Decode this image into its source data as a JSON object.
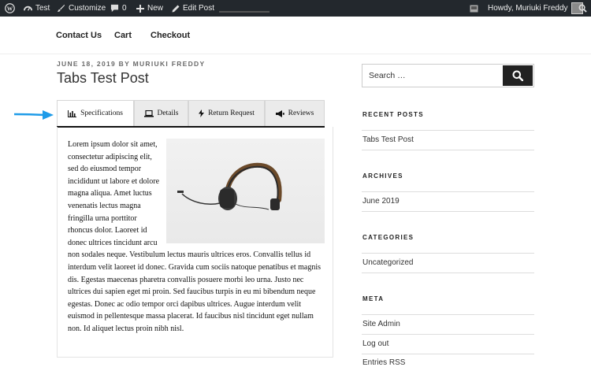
{
  "admin_bar": {
    "site_name": "Test",
    "customize": "Customize",
    "comments_count": "0",
    "new": "New",
    "edit_post": "Edit Post",
    "howdy": "Howdy, Muriuki Freddy"
  },
  "nav": {
    "items": [
      "Contact Us",
      "Cart",
      "Checkout"
    ]
  },
  "post": {
    "meta": "JUNE 18, 2019 BY MURIUKI FREDDY",
    "title": "Tabs Test Post"
  },
  "tabs": [
    {
      "label": "Specifications",
      "icon": "bar-chart-icon",
      "active": true
    },
    {
      "label": "Details",
      "icon": "laptop-icon",
      "active": false
    },
    {
      "label": "Return Request",
      "icon": "lightning-icon",
      "active": false
    },
    {
      "label": "Reviews",
      "icon": "megaphone-icon",
      "active": false
    }
  ],
  "content": {
    "text": "Lorem ipsum dolor sit amet, consectetur adipiscing elit, sed do eiusmod tempor incididunt ut labore et dolore magna aliqua. Amet luctus venenatis lectus magna fringilla urna porttitor rhoncus dolor. Laoreet id donec ultrices tincidunt arcu non sodales neque. Vestibulum lectus mauris ultrices eros. Convallis tellus id interdum velit laoreet id donec. Gravida cum sociis natoque penatibus et magnis dis. Egestas maecenas pharetra convallis posuere morbi leo urna. Justo nec ultrices dui sapien eget mi proin. Sed faucibus turpis in eu mi bibendum neque egestas. Donec ac odio tempor orci dapibus ultrices. Augue interdum velit euismod in pellentesque massa placerat. Id faucibus nisl tincidunt eget nullam non. Id aliquet lectus proin nibh nisl."
  },
  "sidebar": {
    "search_placeholder": "Search …",
    "recent_posts_title": "RECENT POSTS",
    "recent_posts": [
      "Tabs Test Post"
    ],
    "archives_title": "ARCHIVES",
    "archives": [
      "June 2019"
    ],
    "categories_title": "CATEGORIES",
    "categories": [
      "Uncategorized"
    ],
    "meta_title": "META",
    "meta_links": [
      "Site Admin",
      "Log out",
      "Entries RSS"
    ]
  },
  "colors": {
    "admin_bar": "#23282d",
    "accent_arrow": "#1e9be8",
    "search_button": "#222222"
  }
}
